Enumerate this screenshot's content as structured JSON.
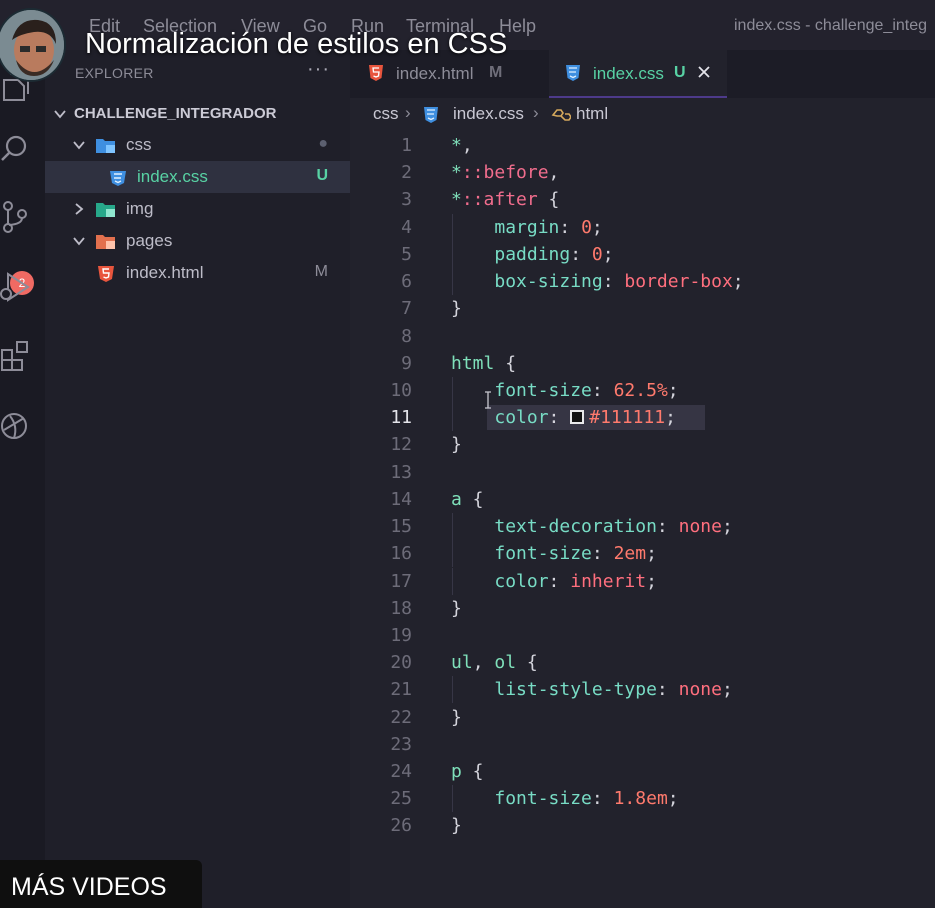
{
  "menubar": {
    "items": [
      "Edit",
      "Selection",
      "View",
      "Go",
      "Run",
      "Terminal",
      "Help"
    ],
    "window_title": "index.css - challenge_integ"
  },
  "overlay": {
    "video_title": "Normalización de estilos en CSS",
    "more_videos": "MÁS VIDEOS"
  },
  "activity_bar": {
    "icons": [
      "explorer-icon",
      "search-icon",
      "source-control-icon",
      "run-debug-icon",
      "extensions-icon",
      "remote-explorer-icon"
    ],
    "source_control_badge": "2"
  },
  "sidebar": {
    "title": "EXPLORER",
    "folder": "CHALLENGE_INTEGRADOR",
    "tree": [
      {
        "label": "css",
        "type": "folder",
        "expanded": true,
        "status": "●"
      },
      {
        "label": "index.css",
        "type": "css-file",
        "status": "U",
        "selected": true
      },
      {
        "label": "img",
        "type": "folder",
        "expanded": false,
        "status": ""
      },
      {
        "label": "pages",
        "type": "folder",
        "expanded": true,
        "status": ""
      },
      {
        "label": "index.html",
        "type": "html-file",
        "status": "M"
      }
    ]
  },
  "tabs": [
    {
      "label": "index.html",
      "status": "M",
      "active": false
    },
    {
      "label": "index.css",
      "status": "U",
      "active": true
    }
  ],
  "breadcrumb": [
    "css",
    "index.css",
    "html"
  ],
  "editor": {
    "current_line": 11,
    "lines": [
      {
        "n": "1",
        "code": "*,"
      },
      {
        "n": "2",
        "code": "*::before,"
      },
      {
        "n": "3",
        "code": "*::after {"
      },
      {
        "n": "4",
        "code": "    margin: 0;"
      },
      {
        "n": "5",
        "code": "    padding: 0;"
      },
      {
        "n": "6",
        "code": "    box-sizing: border-box;"
      },
      {
        "n": "7",
        "code": "}"
      },
      {
        "n": "8",
        "code": ""
      },
      {
        "n": "9",
        "code": "html {"
      },
      {
        "n": "10",
        "code": "    font-size: 62.5%;"
      },
      {
        "n": "11",
        "code": "    color: #111111;"
      },
      {
        "n": "12",
        "code": "}"
      },
      {
        "n": "13",
        "code": ""
      },
      {
        "n": "14",
        "code": "a {"
      },
      {
        "n": "15",
        "code": "    text-decoration: none;"
      },
      {
        "n": "16",
        "code": "    font-size: 2em;"
      },
      {
        "n": "17",
        "code": "    color: inherit;"
      },
      {
        "n": "18",
        "code": "}"
      },
      {
        "n": "19",
        "code": ""
      },
      {
        "n": "20",
        "code": "ul, ol {"
      },
      {
        "n": "21",
        "code": "    list-style-type: none;"
      },
      {
        "n": "22",
        "code": "}"
      },
      {
        "n": "23",
        "code": ""
      },
      {
        "n": "24",
        "code": "p {"
      },
      {
        "n": "25",
        "code": "    font-size: 1.8em;"
      },
      {
        "n": "26",
        "code": "}"
      }
    ]
  },
  "colors": {
    "accent_untracked": "#58d2a4",
    "badge": "#f06a63",
    "color_swatch": "#111111"
  }
}
